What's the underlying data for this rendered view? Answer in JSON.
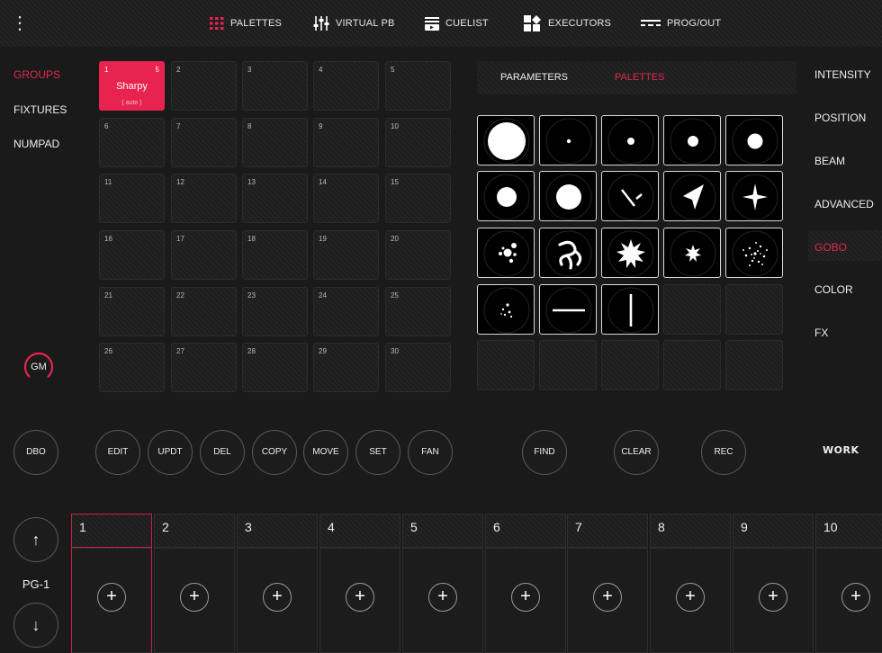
{
  "colors": {
    "accent": "#e8234f",
    "background": "#1a1a1a"
  },
  "topnav": {
    "menu_icon": "kebab-menu-icon",
    "items": [
      {
        "label": "PALETTES",
        "icon": "palette-grid-icon"
      },
      {
        "label": "VIRTUAL PB",
        "icon": "faders-icon"
      },
      {
        "label": "CUELIST",
        "icon": "cuelist-icon"
      },
      {
        "label": "EXECUTORS",
        "icon": "executors-icon"
      },
      {
        "label": "PROG/OUT",
        "icon": "prog-out-icon"
      }
    ]
  },
  "left_menu": {
    "items": [
      "GROUPS",
      "FIXTURES",
      "NUMPAD"
    ],
    "active": "GROUPS"
  },
  "groups": {
    "cells": [
      "1",
      "2",
      "3",
      "4",
      "5",
      "6",
      "7",
      "8",
      "9",
      "10",
      "11",
      "12",
      "13",
      "14",
      "15",
      "16",
      "17",
      "18",
      "19",
      "20",
      "21",
      "22",
      "23",
      "24",
      "25",
      "26",
      "27",
      "28",
      "29",
      "30"
    ],
    "active": {
      "number": "1",
      "count": "5",
      "name": "Sharpy",
      "sub": "( auto )"
    }
  },
  "gm_label": "GM",
  "tabs": {
    "parameters": "PARAMETERS",
    "palettes": "PALETTES",
    "active": "PALETTES"
  },
  "palette_icons": [
    "large-circle-gobo-icon",
    "tiny-dot-gobo-icon",
    "small-dot-gobo-icon",
    "medium-dot-gobo-icon",
    "large-dot-gobo-icon",
    "medium-circle-gobo-icon",
    "big-circle-gobo-icon",
    "slash-gobo-icon",
    "arrow-gobo-icon",
    "star-gobo-icon",
    "dots-cluster-gobo-icon",
    "swirl-gobo-icon",
    "burst-gobo-icon",
    "small-burst-gobo-icon",
    "sparkle-gobo-icon",
    "scatter-dots-gobo-icon",
    "horizontal-line-gobo-icon",
    "vertical-line-gobo-icon"
  ],
  "right_menu": {
    "items": [
      "INTENSITY",
      "POSITION",
      "BEAM",
      "ADVANCED",
      "GOBO",
      "COLOR",
      "FX"
    ],
    "active": "GOBO"
  },
  "buttons": {
    "dbo": "DBO",
    "edit": "EDIT",
    "updt": "UPDT",
    "del": "DEL",
    "copy": "COPY",
    "move": "MOVE",
    "set": "SET",
    "fan": "FAN",
    "find": "FIND",
    "clear": "CLEAR",
    "rec": "REC"
  },
  "logo": "WORK",
  "executors": {
    "items": [
      "1",
      "2",
      "3",
      "4",
      "5",
      "6",
      "7",
      "8",
      "9",
      "10"
    ],
    "active": "1",
    "plus": "+",
    "page_label": "PG-1",
    "up_arrow": "↑",
    "down_arrow": "↓"
  },
  "menu_glyph": "⋮"
}
